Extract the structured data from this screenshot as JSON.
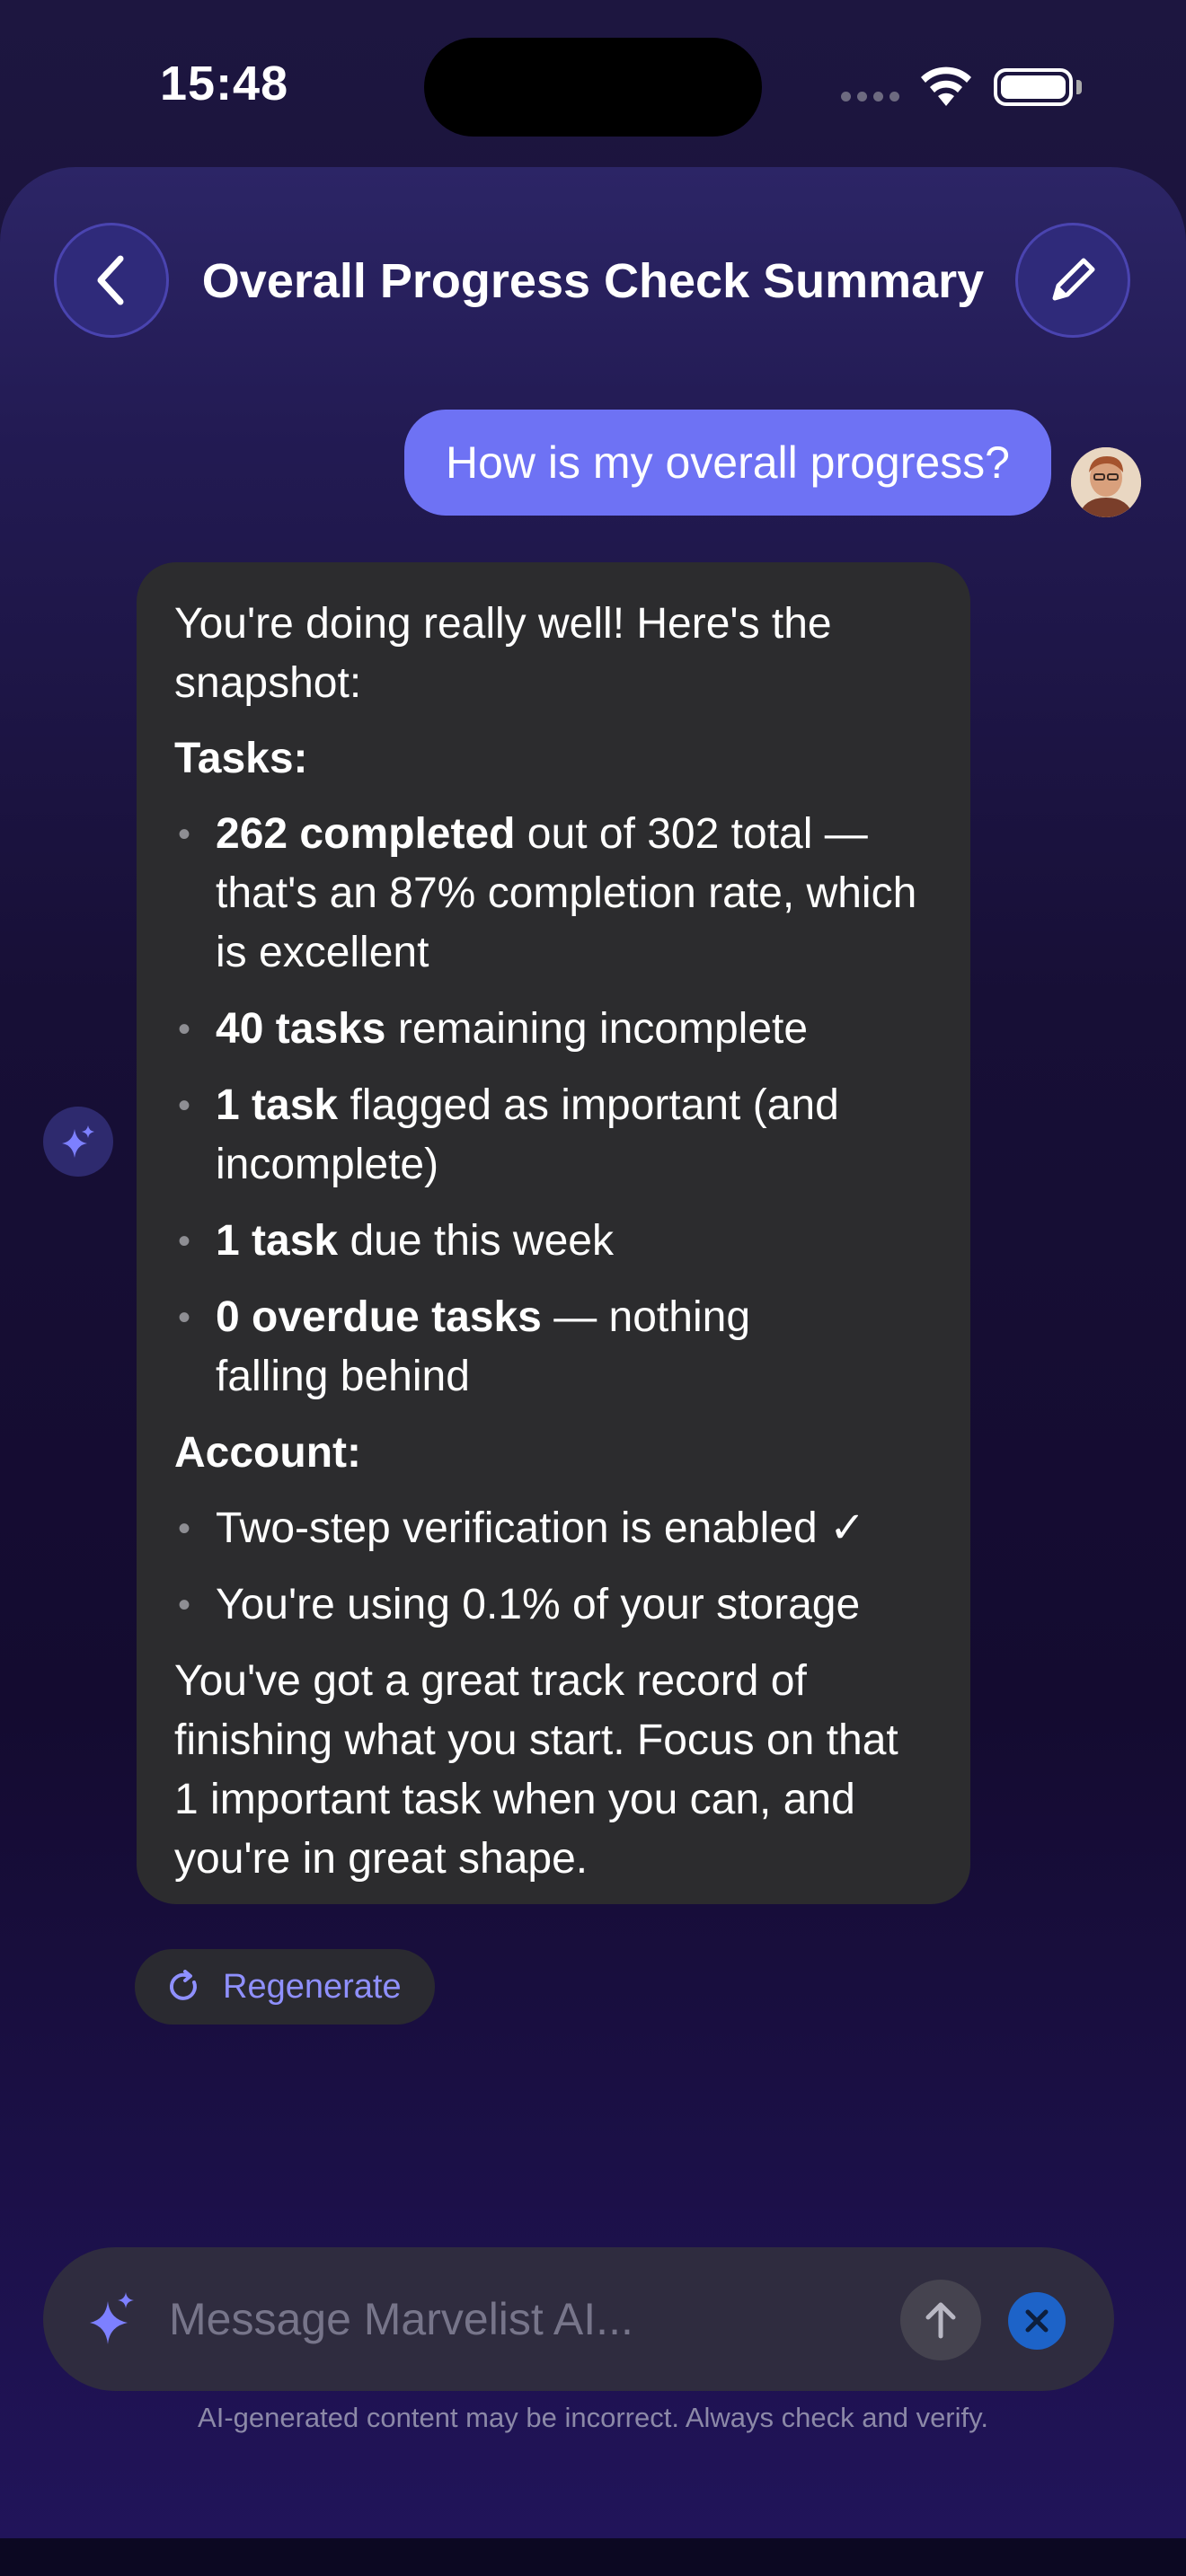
{
  "status_bar": {
    "time": "15:48"
  },
  "header": {
    "title": "Overall Progress Check Summary"
  },
  "user_message": {
    "text": "How is my overall progress?"
  },
  "assistant_message": {
    "intro": "You're doing really well! Here's the snapshot:",
    "tasks_heading": "Tasks:",
    "tasks": [
      {
        "bold": "262 completed",
        "text": " out of 302 total — that's an 87% completion rate, which is excellent"
      },
      {
        "bold": "40 tasks",
        "text": " remaining incomplete"
      },
      {
        "bold": "1 task",
        "text": " flagged as important (and incomplete)"
      },
      {
        "bold": "1 task",
        "text": " due this week"
      },
      {
        "bold": "0 overdue tasks",
        "text": " — nothing falling behind"
      }
    ],
    "account_heading": "Account:",
    "account": [
      {
        "text": "Two-step verification is enabled ✓"
      },
      {
        "text": "You're using 0.1% of your storage"
      }
    ],
    "closing": "You've got a great track record of finishing what you start. Focus on that 1 important task when you can, and you're in great shape."
  },
  "regenerate": {
    "label": "Regenerate"
  },
  "input": {
    "placeholder": "Message Marvelist AI..."
  },
  "disclaimer": "AI-generated content may be incorrect. Always check and verify.",
  "icons": {
    "back": "chevron-left-icon",
    "edit": "pencil-icon",
    "ai": "sparkle-icon",
    "regenerate": "refresh-icon",
    "send": "arrow-up-icon",
    "close": "close-icon"
  },
  "colors": {
    "accent": "#6e72f4",
    "bubble": "#2c2c2e",
    "regenerate_text": "#8f90ff",
    "close_button": "#1d63c8"
  }
}
